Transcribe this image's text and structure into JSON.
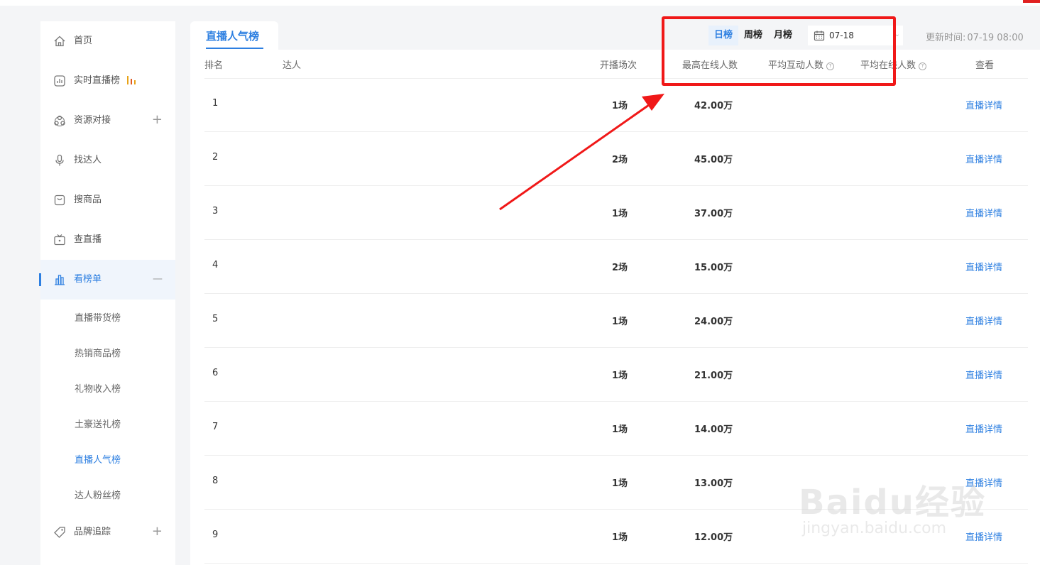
{
  "sidebar": {
    "items": [
      {
        "label": "首页",
        "icon": "home-icon"
      },
      {
        "label": "实时直播榜",
        "icon": "chart-card-icon"
      },
      {
        "label": "资源对接",
        "icon": "resource-icon",
        "toggle": "+"
      },
      {
        "label": "找达人",
        "icon": "microphone-icon"
      },
      {
        "label": "搜商品",
        "icon": "shopping-bag-icon"
      },
      {
        "label": "查直播",
        "icon": "tv-icon"
      },
      {
        "label": "看榜单",
        "icon": "bar-chart-icon",
        "toggle": "—"
      },
      {
        "label": "品牌追踪",
        "icon": "tag-icon",
        "toggle": "+"
      }
    ],
    "sub_items": [
      "直播带货榜",
      "热销商品榜",
      "礼物收入榜",
      "土豪送礼榜",
      "直播人气榜",
      "达人粉丝榜"
    ],
    "active_item": "看榜单",
    "active_sub_item": "直播人气榜"
  },
  "tabs": {
    "active": "直播人气榜"
  },
  "filters": {
    "periods": [
      "日榜",
      "周榜",
      "月榜"
    ],
    "active_period": "日榜",
    "date": "07-18"
  },
  "update_time": {
    "label": "更新时间:",
    "value": "07-19 08:00"
  },
  "table": {
    "headers": {
      "rank": "排名",
      "creator": "达人",
      "sessions": "开播场次",
      "peak_online": "最高在线人数",
      "avg_interaction": "平均互动人数",
      "avg_online": "平均在线人数",
      "view": "查看"
    },
    "rows": [
      {
        "rank": "1",
        "sessions": "1场",
        "peak": "42.00万",
        "link": "直播详情"
      },
      {
        "rank": "2",
        "sessions": "2场",
        "peak": "45.00万",
        "link": "直播详情"
      },
      {
        "rank": "3",
        "sessions": "1场",
        "peak": "37.00万",
        "link": "直播详情"
      },
      {
        "rank": "4",
        "sessions": "2场",
        "peak": "15.00万",
        "link": "直播详情"
      },
      {
        "rank": "5",
        "sessions": "1场",
        "peak": "24.00万",
        "link": "直播详情"
      },
      {
        "rank": "6",
        "sessions": "1场",
        "peak": "21.00万",
        "link": "直播详情"
      },
      {
        "rank": "7",
        "sessions": "1场",
        "peak": "14.00万",
        "link": "直播详情"
      },
      {
        "rank": "8",
        "sessions": "1场",
        "peak": "13.00万",
        "link": "直播详情"
      },
      {
        "rank": "9",
        "sessions": "1场",
        "peak": "12.00万",
        "link": "直播详情"
      }
    ]
  },
  "watermark": {
    "logo": "Baidu经验",
    "url": "jingyan.baidu.com"
  },
  "colors": {
    "accent": "#2d7fe1",
    "annotation": "#f01818"
  }
}
